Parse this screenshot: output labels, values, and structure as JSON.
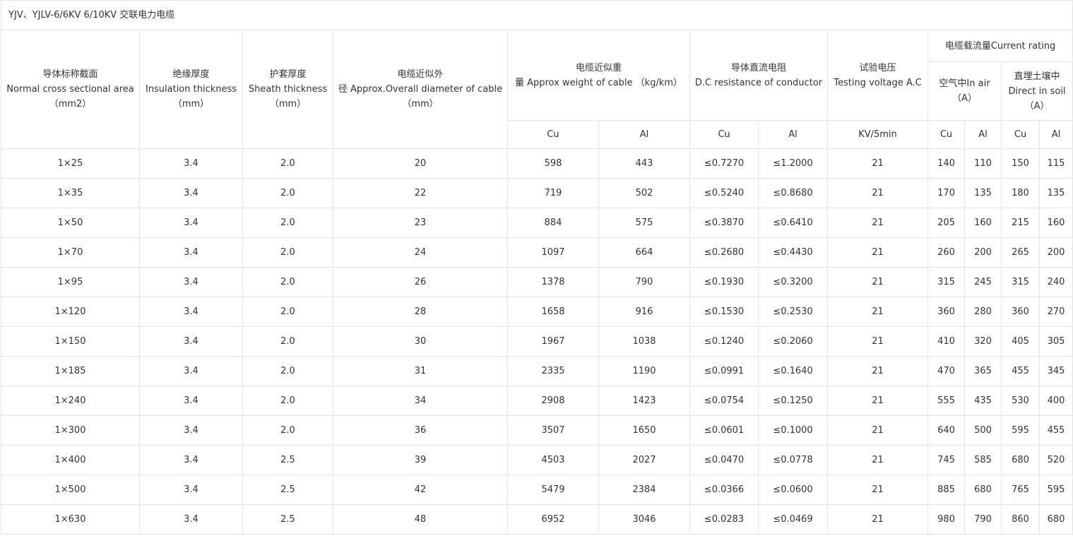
{
  "title": "YJV、YJLV-6/6KV 6/10KV  交联电力电缆",
  "headers": {
    "section": [
      "导体标称截面",
      "Normal cross sectional area",
      "（mm2）"
    ],
    "insulation": [
      "绝缘厚度",
      "Insulation thickness",
      "（mm）"
    ],
    "sheath": [
      "护套厚度",
      "Sheath thickness",
      "（mm）"
    ],
    "diameter": [
      "电缆近似外",
      "径 Approx.Overall diameter of cable",
      "（mm）"
    ],
    "weight": [
      "电缆近似重",
      "量 Approx weight of cable （kg/km）"
    ],
    "resistance": [
      "导体直流电阻",
      "D.C resistance of conductor"
    ],
    "voltage": [
      "试验电压",
      "Testing voltage A.C"
    ],
    "current": "电缆载流量Current rating",
    "air": [
      "空气中In air",
      "（A）"
    ],
    "soil": [
      "直埋土壤中",
      "Direct in soil",
      "（A）"
    ],
    "sub": {
      "weight_cu": "Cu",
      "weight_al": "Al",
      "res_cu": "Cu",
      "res_al": "Al",
      "volt_unit": "KV/5min",
      "air_cu": "Cu",
      "air_al": "Al",
      "soil_cu": "Cu",
      "soil_al": "Al"
    }
  },
  "rows": [
    [
      "1×25",
      "3.4",
      "2.0",
      "20",
      "598",
      "443",
      "≤0.7270",
      "≤1.2000",
      "21",
      "140",
      "110",
      "150",
      "115"
    ],
    [
      "1×35",
      "3.4",
      "2.0",
      "22",
      "719",
      "502",
      "≤0.5240",
      "≤0.8680",
      "21",
      "170",
      "135",
      "180",
      "135"
    ],
    [
      "1×50",
      "3.4",
      "2.0",
      "23",
      "884",
      "575",
      "≤0.3870",
      "≤0.6410",
      "21",
      "205",
      "160",
      "215",
      "160"
    ],
    [
      "1×70",
      "3.4",
      "2.0",
      "24",
      "1097",
      "664",
      "≤0.2680",
      "≤0.4430",
      "21",
      "260",
      "200",
      "265",
      "200"
    ],
    [
      "1×95",
      "3.4",
      "2.0",
      "26",
      "1378",
      "790",
      "≤0.1930",
      "≤0.3200",
      "21",
      "315",
      "245",
      "315",
      "240"
    ],
    [
      "1×120",
      "3.4",
      "2.0",
      "28",
      "1658",
      "916",
      "≤0.1530",
      "≤0.2530",
      "21",
      "360",
      "280",
      "360",
      "270"
    ],
    [
      "1×150",
      "3.4",
      "2.0",
      "30",
      "1967",
      "1038",
      "≤0.1240",
      "≤0.2060",
      "21",
      "410",
      "320",
      "405",
      "305"
    ],
    [
      "1×185",
      "3.4",
      "2.0",
      "31",
      "2335",
      "1190",
      "≤0.0991",
      "≤0.1640",
      "21",
      "470",
      "365",
      "455",
      "345"
    ],
    [
      "1×240",
      "3.4",
      "2.0",
      "34",
      "2908",
      "1423",
      "≤0.0754",
      "≤0.1250",
      "21",
      "555",
      "435",
      "530",
      "400"
    ],
    [
      "1×300",
      "3.4",
      "2.0",
      "36",
      "3507",
      "1650",
      "≤0.0601",
      "≤0.1000",
      "21",
      "640",
      "500",
      "595",
      "455"
    ],
    [
      "1×400",
      "3.4",
      "2.5",
      "39",
      "4503",
      "2027",
      "≤0.0470",
      "≤0.0778",
      "21",
      "745",
      "585",
      "680",
      "520"
    ],
    [
      "1×500",
      "3.4",
      "2.5",
      "42",
      "5479",
      "2384",
      "≤0.0366",
      "≤0.0600",
      "21",
      "885",
      "680",
      "765",
      "595"
    ],
    [
      "1×630",
      "3.4",
      "2.5",
      "48",
      "6952",
      "3046",
      "≤0.0283",
      "≤0.0469",
      "21",
      "980",
      "790",
      "860",
      "680"
    ]
  ]
}
